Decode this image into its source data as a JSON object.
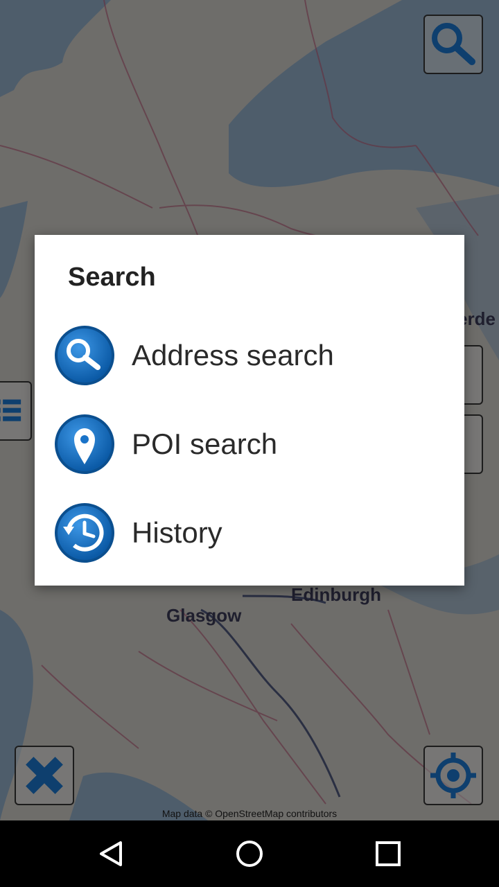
{
  "map": {
    "cities": [
      "Edinburgh",
      "Glasgow",
      "erde"
    ],
    "attribution": "Map data © OpenStreetMap contributors",
    "buttons": {
      "search_icon": "magnifier-icon",
      "ruler_icon": "ruler-close-icon",
      "locate_icon": "crosshair-icon",
      "list_icon": "list-icon"
    }
  },
  "dialog": {
    "title": "Search",
    "items": [
      {
        "label": "Address search",
        "icon": "magnifier-icon"
      },
      {
        "label": "POI search",
        "icon": "location-pin-icon"
      },
      {
        "label": "History",
        "icon": "history-clock-icon"
      }
    ]
  },
  "navbar": {
    "back_icon": "back-triangle-icon",
    "home_icon": "home-circle-icon",
    "recents_icon": "recents-square-icon"
  },
  "colors": {
    "icon_blue": "#1a73c8",
    "icon_blue_dark": "#0b4f8f",
    "map_bg": "#c9c6c2",
    "sea": "#8fa9c4"
  }
}
